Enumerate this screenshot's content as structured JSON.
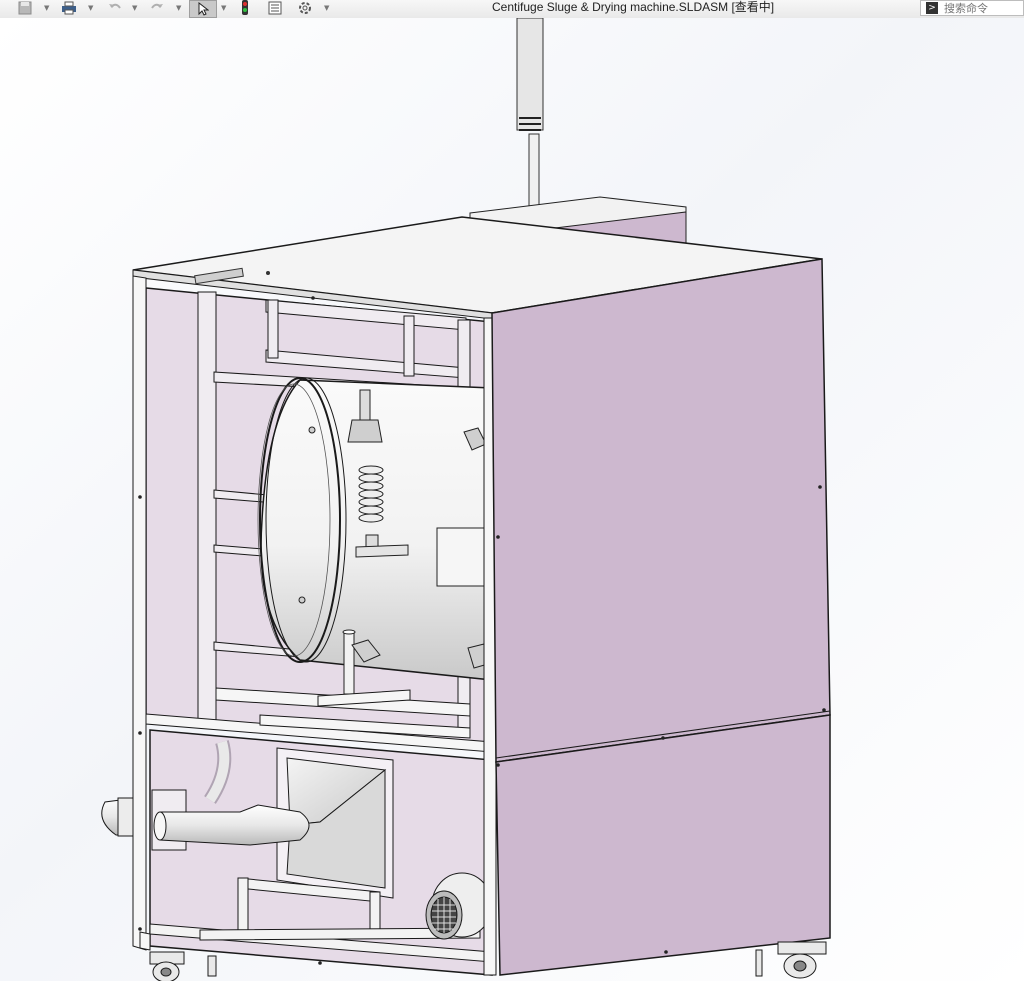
{
  "window": {
    "title": "Centifuge Sluge & Drying machine.SLDASM [查看中]"
  },
  "toolbar": {
    "items": [
      "save-icon",
      "print-icon",
      "undo-icon",
      "redo-icon",
      "select-cursor-icon",
      "rebuild-traffic-light-icon",
      "file-properties-icon",
      "options-gear-icon"
    ]
  },
  "search": {
    "placeholder": "搜索命令"
  },
  "heads_up_toolbar": {
    "items": [
      "zoom-to-fit-icon",
      "zoom-to-area-icon",
      "previous-view-icon",
      "section-view-icon",
      "view-orientation-icon",
      "display-style-icon",
      "hide-show-items-icon",
      "edit-appearance-icon",
      "apply-scene-icon",
      "view-settings-icon"
    ]
  },
  "colors": {
    "panel_lilac": "#cdb8cf",
    "panel_lilac_light": "#e6dbe7",
    "frame_line": "#1a1a1a",
    "top_lid": "#f4f4f4",
    "viewport_bg": "#ffffff",
    "accent_select": "#c9c9c9"
  }
}
